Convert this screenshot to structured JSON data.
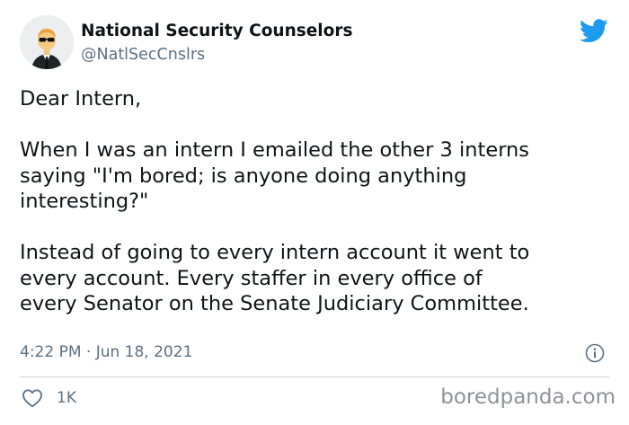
{
  "author": {
    "name": "National Security Counselors",
    "handle": "@NatlSecCnslrs",
    "avatar_icon": "agent-avatar"
  },
  "tweet": {
    "paragraphs": [
      [
        "Dear Intern,"
      ],
      [
        "When I was an intern I emailed the other 3 interns",
        "saying \"I'm bored; is anyone doing anything",
        "interesting?\""
      ],
      [
        "Instead of going to every intern account it went to",
        "every account. Every staffer in every office of",
        "every Senator on the Senate Judiciary Committee."
      ]
    ],
    "timestamp": "4:22 PM · Jun 18, 2021"
  },
  "actions": {
    "like_count": "1K",
    "like_icon": "heart-icon",
    "info_icon": "info-icon"
  },
  "brand": {
    "twitter_icon": "twitter-bird-icon",
    "twitter_color": "#1d9bf0",
    "watermark": "boredpanda.com"
  }
}
